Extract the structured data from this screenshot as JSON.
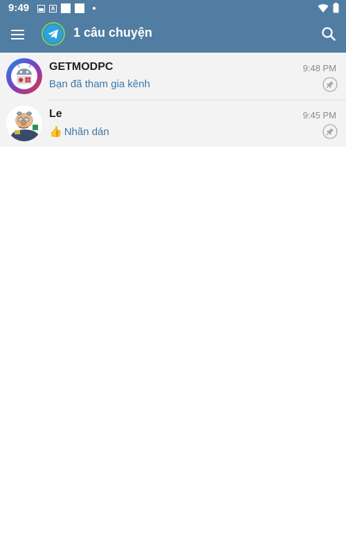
{
  "status_bar": {
    "time": "9:49",
    "icons_left": [
      "image-icon",
      "a-notification-icon",
      "white-square-icon",
      "white-square-icon",
      "dot-icon"
    ],
    "icons_right": [
      "wifi-icon",
      "battery-icon"
    ]
  },
  "app_bar": {
    "title": "1 câu chuyện",
    "menu_icon": "hamburger-menu-icon",
    "logo_icon": "telegram-logo-icon",
    "search_icon": "search-icon"
  },
  "chats": [
    {
      "name": "GETMODPC",
      "time": "9:48 PM",
      "message": "Bạn đã tham gia kênh",
      "avatar_icon": "android-apple-windows-logo-icon",
      "pinned": true
    },
    {
      "name": "Le",
      "time": "9:45 PM",
      "message_emoji": "👍",
      "message": "Nhãn dán",
      "avatar_icon": "cartoon-character-avatar",
      "pinned": true
    }
  ],
  "colors": {
    "header": "#517da2",
    "message_text": "#3a77a8",
    "row_background": "#f3f3f3"
  }
}
